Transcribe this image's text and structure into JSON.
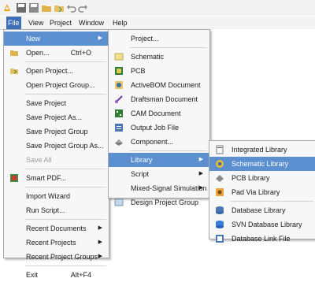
{
  "menubar": {
    "items": [
      {
        "label": "File",
        "active": true
      },
      {
        "label": "View"
      },
      {
        "label": "Project"
      },
      {
        "label": "Window"
      },
      {
        "label": "Help"
      }
    ]
  },
  "file_menu": {
    "items": [
      {
        "label": "New",
        "arrow": true,
        "highlight": true
      },
      {
        "label": "Open...",
        "shortcut": "Ctrl+O",
        "icon": "folder-open-icon"
      },
      {
        "sep": true
      },
      {
        "label": "Open Project...",
        "icon": "open-project-icon"
      },
      {
        "label": "Open Project Group..."
      },
      {
        "sep": true
      },
      {
        "label": "Save Project"
      },
      {
        "label": "Save Project As..."
      },
      {
        "label": "Save Project Group"
      },
      {
        "label": "Save Project Group As..."
      },
      {
        "label": "Save All",
        "disabled": true
      },
      {
        "sep": true
      },
      {
        "label": "Smart PDF...",
        "icon": "smart-pdf-icon"
      },
      {
        "sep": true
      },
      {
        "label": "Import Wizard"
      },
      {
        "label": "Run Script..."
      },
      {
        "sep": true
      },
      {
        "label": "Recent Documents",
        "arrow": true
      },
      {
        "label": "Recent Projects",
        "arrow": true
      },
      {
        "label": "Recent Project Groups",
        "arrow": true
      },
      {
        "sep": true
      },
      {
        "label": "Exit",
        "shortcut": "Alt+F4"
      }
    ]
  },
  "new_menu": {
    "items": [
      {
        "label": "Project..."
      },
      {
        "sep": true
      },
      {
        "label": "Schematic",
        "icon": "schematic-icon"
      },
      {
        "label": "PCB",
        "icon": "pcb-icon"
      },
      {
        "label": "ActiveBOM Document",
        "icon": "activebom-icon"
      },
      {
        "label": "Draftsman Document",
        "icon": "draftsman-icon"
      },
      {
        "label": "CAM Document",
        "icon": "cam-icon"
      },
      {
        "label": "Output Job File",
        "icon": "output-job-icon"
      },
      {
        "label": "Component...",
        "icon": "component-icon"
      },
      {
        "sep": true
      },
      {
        "label": "Library",
        "arrow": true,
        "highlight": true
      },
      {
        "label": "Script",
        "arrow": true
      },
      {
        "label": "Mixed-Signal Simulation",
        "arrow": true
      },
      {
        "label": "Design Project Group",
        "icon": "project-group-icon"
      }
    ]
  },
  "library_menu": {
    "items": [
      {
        "label": "Integrated Library",
        "icon": "integrated-library-icon"
      },
      {
        "label": "Schematic Library",
        "icon": "schematic-library-icon",
        "highlight": true
      },
      {
        "label": "PCB Library",
        "icon": "pcb-library-icon"
      },
      {
        "label": "Pad Via Library",
        "icon": "pad-via-library-icon"
      },
      {
        "sep": true
      },
      {
        "label": "Database Library",
        "icon": "database-library-icon"
      },
      {
        "label": "SVN Database Library",
        "icon": "svn-database-library-icon"
      },
      {
        "label": "Database Link File",
        "icon": "database-link-file-icon"
      }
    ]
  }
}
